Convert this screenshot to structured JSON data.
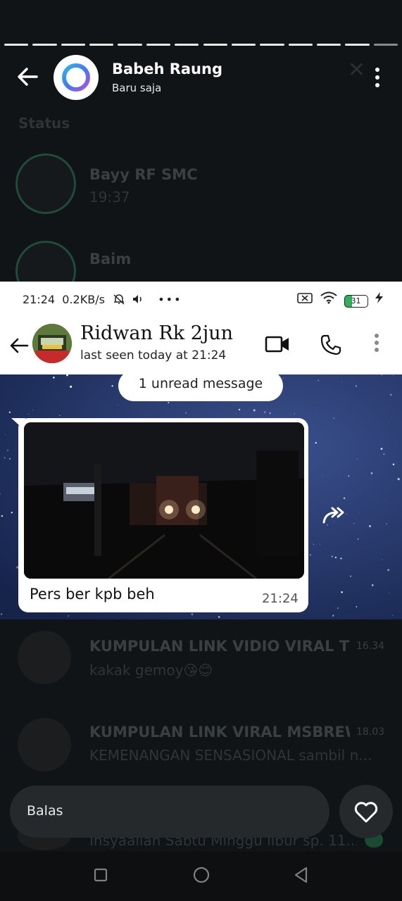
{
  "background_list": {
    "section_label": "Status",
    "rows": [
      {
        "name": "Bayy RF SMC",
        "sub": "19:37",
        "time": ""
      },
      {
        "name": "Baim",
        "sub": "",
        "time": ""
      },
      {
        "name": "KUMPULAN LINK VIDIO VIRAL TE...",
        "sub": "kakak gemoy😘😊",
        "time": "16.34"
      },
      {
        "name": "KUMPULAN LINK VIRAL MSBREW...",
        "sub": "KEMENANGAN SENSASIONAL sambil n...",
        "time": "18.03"
      },
      {
        "name": "",
        "sub": "Insyaallah Sabtu Minggu libur sp. 11...",
        "time": ""
      }
    ]
  },
  "story": {
    "segments": 14,
    "author": "Babeh Raung",
    "posted": "Baru saja"
  },
  "screenshot": {
    "status_bar": {
      "time": "21:24",
      "speed": "0.2KB/s",
      "more": "•••",
      "battery": "31"
    },
    "chat_header": {
      "name": "Ridwan Rk 2jun",
      "last_seen": "last seen today at 21:24"
    },
    "unread_label": "1 unread message",
    "message": {
      "caption": "Pers ber kpb beh",
      "time": "21:24"
    }
  },
  "reply_bar": {
    "placeholder": "Balas"
  },
  "icons": {
    "back": "back-arrow-icon",
    "menu": "more-vert-icon",
    "video": "video-call-icon",
    "phone": "phone-icon",
    "forward": "forward-icon",
    "heart": "heart-icon"
  },
  "colors": {
    "status_ring": "#1d4d36",
    "chat_wallpaper": "#1e2f5e",
    "reply_bg": "#25292b"
  }
}
